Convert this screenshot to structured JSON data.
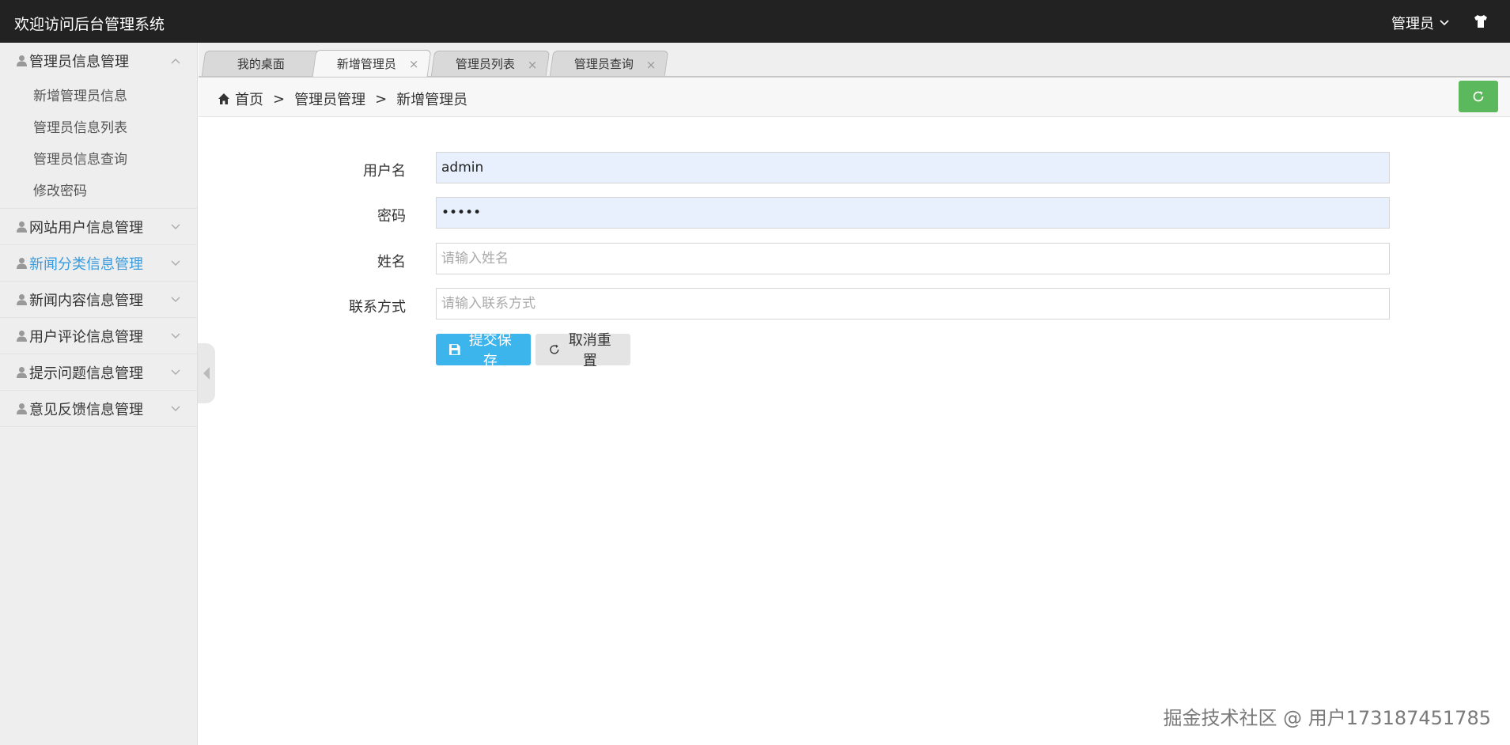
{
  "header": {
    "title": "欢迎访问后台管理系统",
    "user_label": "管理员"
  },
  "sidebar": {
    "groups": [
      {
        "label": "管理员信息管理",
        "expanded": true,
        "items": [
          "新增管理员信息",
          "管理员信息列表",
          "管理员信息查询",
          "修改密码"
        ]
      },
      {
        "label": "网站用户信息管理",
        "expanded": false
      },
      {
        "label": "新闻分类信息管理",
        "expanded": false,
        "highlight": true
      },
      {
        "label": "新闻内容信息管理",
        "expanded": false
      },
      {
        "label": "用户评论信息管理",
        "expanded": false
      },
      {
        "label": "提示问题信息管理",
        "expanded": false
      },
      {
        "label": "意见反馈信息管理",
        "expanded": false
      }
    ]
  },
  "tabs": [
    {
      "label": "我的桌面",
      "closable": false
    },
    {
      "label": "新增管理员",
      "closable": true,
      "active": true
    },
    {
      "label": "管理员列表",
      "closable": true
    },
    {
      "label": "管理员查询",
      "closable": true
    }
  ],
  "tab_close_glyph": "×",
  "breadcrumb": {
    "home": "首页",
    "level1": "管理员管理",
    "level2": "新增管理员",
    "separator": ">"
  },
  "form": {
    "username": {
      "label": "用户名",
      "value": "admin",
      "placeholder": ""
    },
    "password": {
      "label": "密码",
      "value": "•••••",
      "placeholder": ""
    },
    "name": {
      "label": "姓名",
      "value": "",
      "placeholder": "请输入姓名"
    },
    "contact": {
      "label": "联系方式",
      "value": "",
      "placeholder": "请输入联系方式"
    },
    "submit_label": "提交保存",
    "reset_label": "取消重置"
  },
  "watermark": "掘金技术社区 @ 用户173187451785",
  "colors": {
    "header_bg": "#222222",
    "accent": "#3a9bdc",
    "primary_button": "#3cb5ec",
    "refresh_button": "#5cb85c",
    "filled_input": "#e8f0fe"
  }
}
